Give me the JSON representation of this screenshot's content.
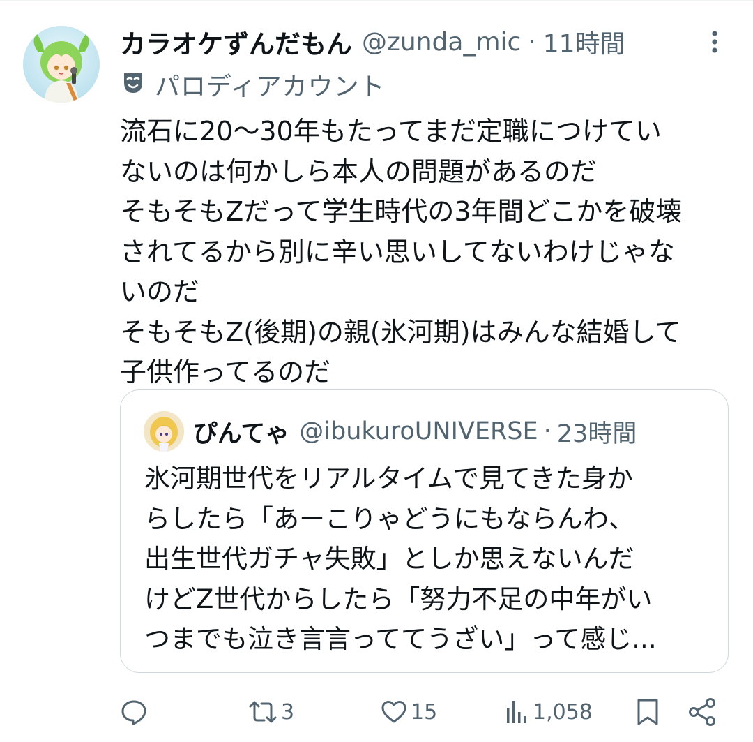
{
  "colors": {
    "text": "#0f1419",
    "secondary": "#536471",
    "border": "#cfd9de"
  },
  "tweet": {
    "author": {
      "name": "カラオケずんだもん",
      "handle": "@zunda_mic",
      "avatar_icon": "zundamon-avatar-icon"
    },
    "separator": "·",
    "time": "11時間",
    "more_icon": "more-vertical-icon",
    "label_icon": "theater-mask-icon",
    "label": "パロディアカウント",
    "text_lines": [
      "流石に20〜30年もたってまだ定職につけてい",
      "ないのは何かしら本人の問題があるのだ",
      "そもそもZだって学生時代の3年間どこかを破壊",
      "されてるから別に辛い思いしてないわけじゃな",
      "いのだ",
      "そもそもZ(後期)の親(氷河期)はみんな結婚して",
      "子供作ってるのだ"
    ]
  },
  "quoted": {
    "author": {
      "name": "ぴんてゃ",
      "handle": "@ibukuroUNIVERSE",
      "avatar_icon": "blonde-character-avatar-icon"
    },
    "separator": "·",
    "time": "23時間",
    "text_lines": [
      "氷河期世代をリアルタイムで見てきた身か",
      "らしたら「あーこりゃどうにもならんわ、",
      "出生世代ガチャ失敗」としか思えないんだ",
      "けどZ世代からしたら「努力不足の中年がい",
      "つまでも泣き言言っててうざい」って感じ..."
    ]
  },
  "actions": {
    "reply": {
      "icon": "reply-icon",
      "count": ""
    },
    "retweet": {
      "icon": "retweet-icon",
      "count": "3"
    },
    "like": {
      "icon": "heart-icon",
      "count": "15"
    },
    "views": {
      "icon": "views-chart-icon",
      "count": "1,058"
    },
    "bookmark": {
      "icon": "bookmark-icon"
    },
    "share": {
      "icon": "share-icon"
    }
  }
}
